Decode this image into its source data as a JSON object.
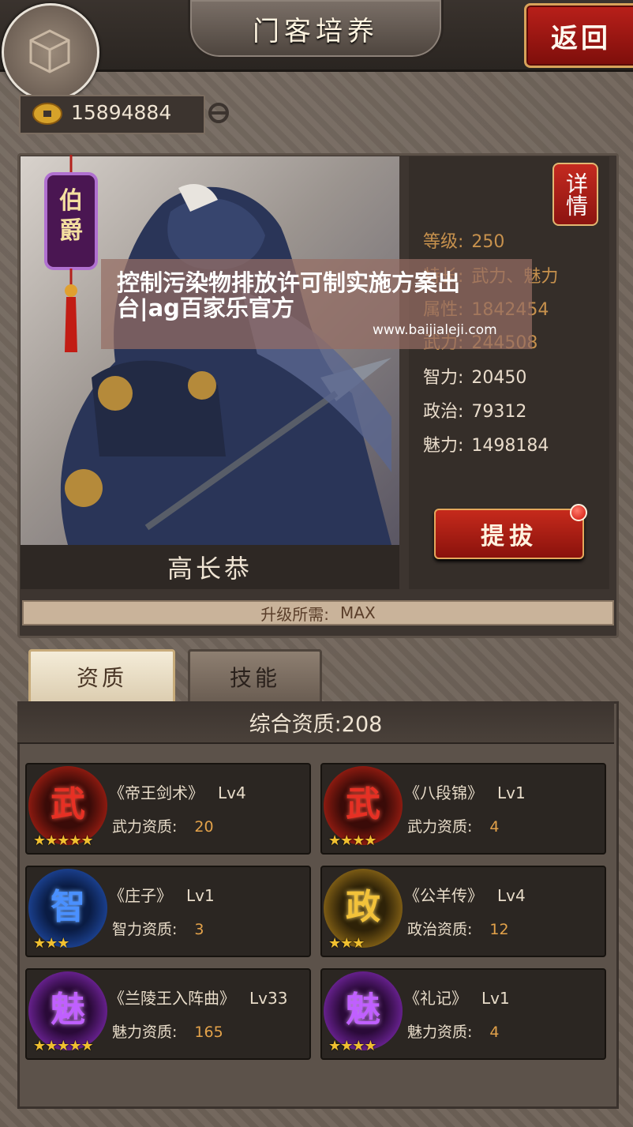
{
  "header": {
    "title": "门客培养",
    "back_label": "返回"
  },
  "currency": {
    "amount": "15894884",
    "icon": "copper-coin-icon"
  },
  "hero": {
    "rank": "伯爵",
    "name": "高长恭",
    "detail_label": "详情",
    "stats": [
      {
        "key": "等级:",
        "value": "250"
      },
      {
        "key": "特长:",
        "value": "武力、魅力"
      },
      {
        "key": "属性:",
        "value": "1842454"
      },
      {
        "key": "武力:",
        "value": "244508"
      },
      {
        "key": "智力:",
        "value": "20450"
      },
      {
        "key": "政治:",
        "value": "79312"
      },
      {
        "key": "魅力:",
        "value": "1498184"
      }
    ],
    "promote_label": "提拔",
    "upgrade_label": "升级所需:",
    "upgrade_value": "MAX"
  },
  "watermark": {
    "text": "控制污染物排放许可制实施方案出台|ag百家乐官方",
    "url": "www.baijialeji.com"
  },
  "tabs": [
    {
      "label": "资质"
    },
    {
      "label": "技能"
    }
  ],
  "aptitude": {
    "total": "综合资质:208",
    "cards": [
      {
        "glyph": "武",
        "color": "#e63024",
        "stars": "★★★★★",
        "skill": "《帝王剑术》",
        "level": "Lv4",
        "label": "武力资质:",
        "value": "20"
      },
      {
        "glyph": "武",
        "color": "#e63024",
        "stars": "★★★★",
        "skill": "《八段锦》",
        "level": "Lv1",
        "label": "武力资质:",
        "value": "4"
      },
      {
        "glyph": "智",
        "color": "#4a90ff",
        "stars": "★★★",
        "skill": "《庄子》",
        "level": "Lv1",
        "label": "智力资质:",
        "value": "3"
      },
      {
        "glyph": "政",
        "color": "#f2c23a",
        "stars": "★★★",
        "skill": "《公羊传》",
        "level": "Lv4",
        "label": "政治资质:",
        "value": "12"
      },
      {
        "glyph": "魅",
        "color": "#c060ff",
        "stars": "★★★★★",
        "skill": "《兰陵王入阵曲》",
        "level": "Lv33",
        "label": "魅力资质:",
        "value": "165"
      },
      {
        "glyph": "魅",
        "color": "#c060ff",
        "stars": "★★★★",
        "skill": "《礼记》",
        "level": "Lv1",
        "label": "魅力资质:",
        "value": "4"
      }
    ]
  }
}
